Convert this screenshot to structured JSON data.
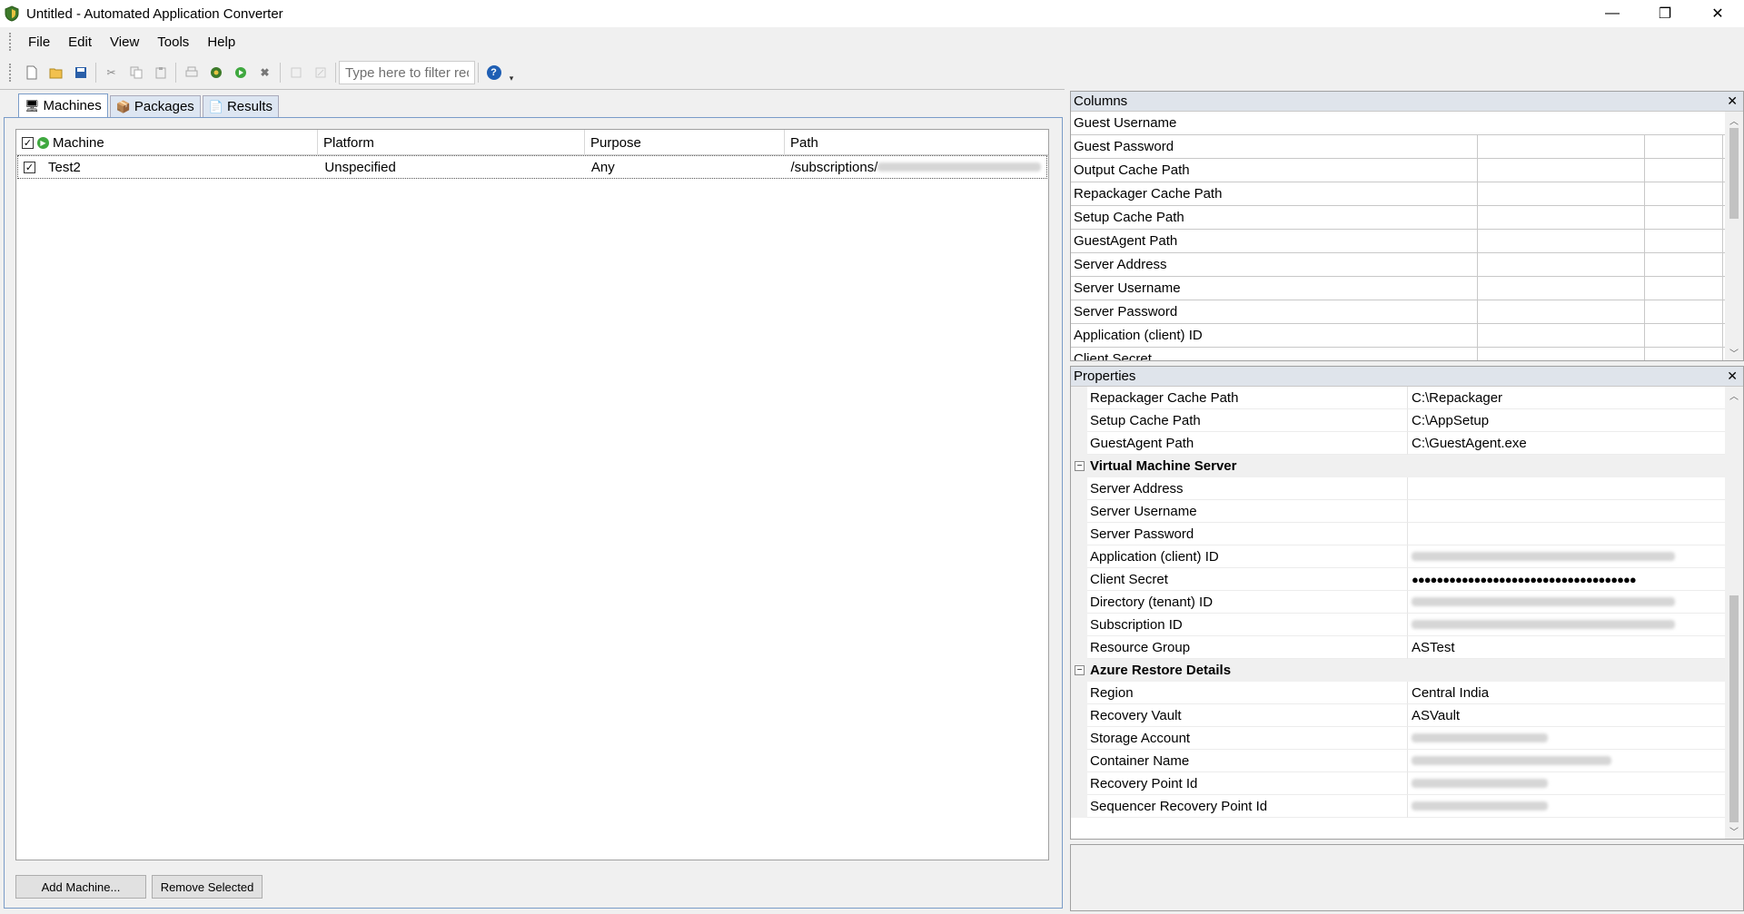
{
  "window": {
    "title": "Untitled - Automated Application Converter",
    "minimize": "—",
    "maximize": "❐",
    "close": "✕"
  },
  "menu": [
    "File",
    "Edit",
    "View",
    "Tools",
    "Help"
  ],
  "toolbar": {
    "filter_placeholder": "Type here to filter rec",
    "help": "?"
  },
  "tabs": [
    {
      "label": "Machines",
      "icon": "monitor-icon",
      "active": true
    },
    {
      "label": "Packages",
      "icon": "package-icon",
      "active": false
    },
    {
      "label": "Results",
      "icon": "document-icon",
      "active": false
    }
  ],
  "machines": {
    "headers": [
      "Machine",
      "Platform",
      "Purpose",
      "Path"
    ],
    "rows": [
      {
        "checked": true,
        "machine": "Test2",
        "platform": "Unspecified",
        "purpose": "Any",
        "path": "/subscriptions/"
      }
    ],
    "add_button": "Add Machine...",
    "remove_button": "Remove Selected"
  },
  "columns_panel": {
    "title": "Columns",
    "close": "✕",
    "rows": [
      "Guest Username",
      "Guest Password",
      "Output Cache Path",
      "Repackager Cache Path",
      "Setup Cache Path",
      "GuestAgent Path",
      "Server Address",
      "Server Username",
      "Server Password",
      "Application (client) ID",
      "Client Secret"
    ]
  },
  "properties_panel": {
    "title": "Properties",
    "close": "✕",
    "top_rows": [
      {
        "name": "Repackager Cache Path",
        "value": "C:\\Repackager"
      },
      {
        "name": "Setup Cache Path",
        "value": "C:\\AppSetup"
      },
      {
        "name": "GuestAgent Path",
        "value": "C:\\GuestAgent.exe"
      }
    ],
    "vm_server": {
      "category": "Virtual Machine Server",
      "rows": [
        {
          "name": "Server Address",
          "value": ""
        },
        {
          "name": "Server Username",
          "value": ""
        },
        {
          "name": "Server Password",
          "value": ""
        },
        {
          "name": "Application (client) ID",
          "value": ""
        },
        {
          "name": "Client Secret",
          "value": "●●●●●●●●●●●●●●●●●●●●●●●●●●●●●●●●●●●●"
        },
        {
          "name": "Directory (tenant) ID",
          "value": ""
        },
        {
          "name": "Subscription ID",
          "value": ""
        },
        {
          "name": "Resource Group",
          "value": "ASTest"
        }
      ]
    },
    "azure_restore": {
      "category": "Azure Restore Details",
      "rows": [
        {
          "name": "Region",
          "value": "Central India"
        },
        {
          "name": "Recovery Vault",
          "value": "ASVault"
        },
        {
          "name": "Storage Account",
          "value": ""
        },
        {
          "name": "Container Name",
          "value": ""
        },
        {
          "name": "Recovery Point Id",
          "value": ""
        },
        {
          "name": "Sequencer Recovery Point Id",
          "value": ""
        }
      ]
    }
  }
}
